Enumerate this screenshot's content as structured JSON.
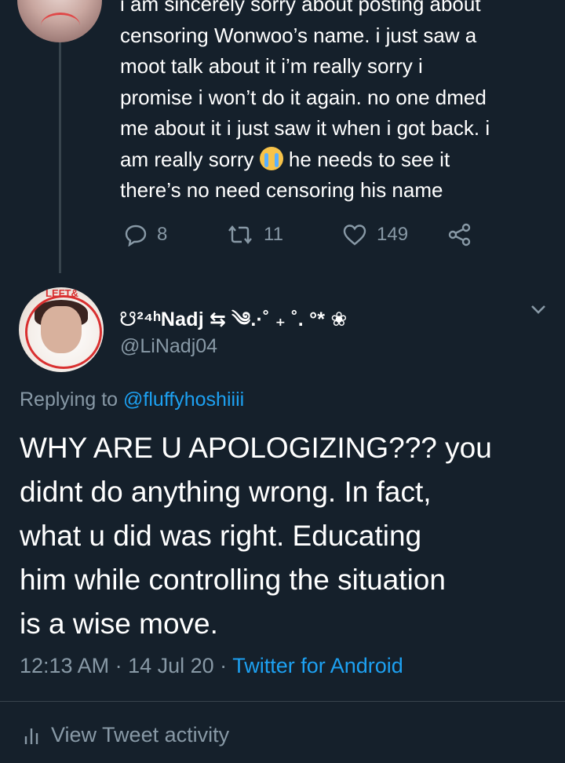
{
  "prev_tweet": {
    "text_lines": [
      "i am sincerely sorry about posting about",
      "censoring Wonwoo’s name. i just saw a",
      "moot talk about it i’m really sorry i",
      "promise i won’t do it again. no one dmed",
      "me about it i just saw it when i got back. i"
    ],
    "line6_before_emoji": "am really sorry ",
    "line6_after_emoji": " he needs to see it",
    "line7": "there’s no need censoring his name",
    "reply_count": "8",
    "retweet_count": "11",
    "like_count": "149",
    "icons": [
      "reply-icon",
      "retweet-icon",
      "like-icon",
      "share-icon"
    ]
  },
  "tweet": {
    "display_name": "☋²⁴ʰNadj ⇆ ༄.·˚ ₊ ˚. °* ❀",
    "handle": "@LiNadj04",
    "avatar_badge": "LEFT&",
    "replying_prefix": "Replying to ",
    "replying_to": "@fluffyhoshiiii",
    "text_lines": [
      "WHY ARE U APOLOGIZING??? you",
      "didnt do anything wrong. In fact,",
      "what u did was right. Educating",
      "him while controlling the situation",
      "is a wise move."
    ],
    "time": "12:13 AM",
    "date": "14 Jul 20",
    "separator": " · ",
    "source": "Twitter for Android",
    "activity_label": "View Tweet activity"
  },
  "colors": {
    "background": "#15202b",
    "text_primary": "#ffffff",
    "text_secondary": "#8899a6",
    "link": "#1da1f2",
    "divider": "#38444d"
  }
}
